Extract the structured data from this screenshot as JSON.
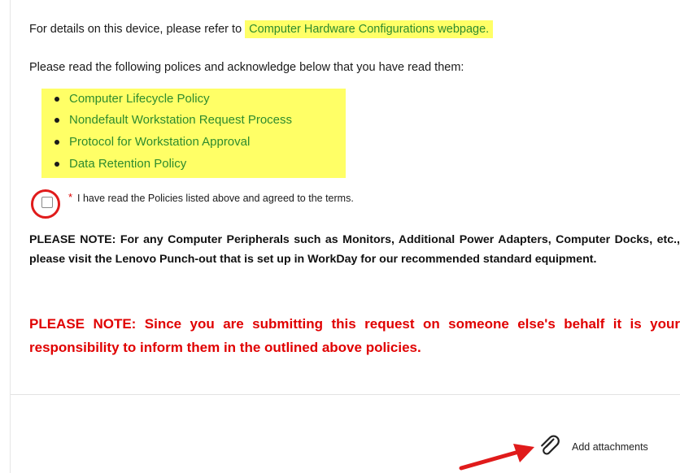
{
  "intro": {
    "text": "For details on this device, please refer to",
    "link_label": "Computer Hardware Configurations webpage."
  },
  "instructions": "Please read the following polices and acknowledge below that you have read them:",
  "policies": [
    "Computer Lifecycle Policy",
    "Nondefault Workstation Request Process",
    "Protocol for Workstation Approval",
    "Data Retention Policy"
  ],
  "acknowledgement": {
    "required_marker": "*",
    "label": "I have read the Policies listed above and agreed to the terms.",
    "checked": false
  },
  "note_peripherals": "PLEASE NOTE: For any Computer Peripherals such as Monitors, Additional Power Adapters, Computer Docks, etc., please visit the Lenovo Punch-out that is set up in WorkDay for our recommended standard equipment.",
  "note_behalf": "PLEASE NOTE: Since you are submitting this request on someone else's behalf it is your responsibility to inform them in the outlined above policies.",
  "attachments": {
    "label": "Add attachments",
    "icon": "paperclip-icon"
  },
  "colors": {
    "highlight": "#ffff66",
    "link_text": "#2e8b2e",
    "warning_text": "#e00000",
    "annotation_red": "#e01b1b"
  }
}
